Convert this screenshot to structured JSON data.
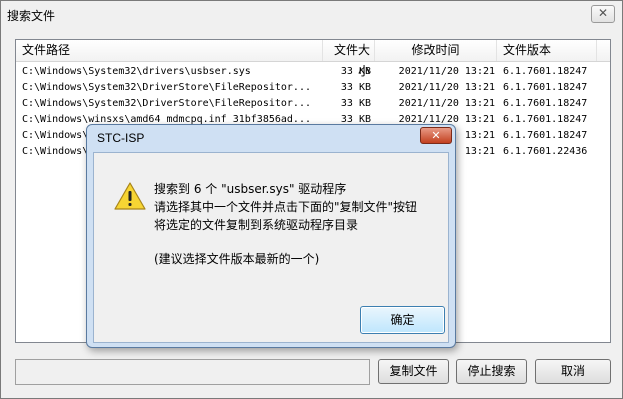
{
  "window": {
    "title": "搜索文件",
    "close_glyph": "✕"
  },
  "table": {
    "columns": [
      "文件路径",
      "文件大小",
      "修改时间",
      "文件版本"
    ],
    "rows": [
      {
        "path": "C:\\Windows\\System32\\drivers\\usbser.sys",
        "size": "33 KB",
        "date": "2021/11/20 13:21",
        "version": "6.1.7601.18247"
      },
      {
        "path": "C:\\Windows\\System32\\DriverStore\\FileRepositor...",
        "size": "33 KB",
        "date": "2021/11/20 13:21",
        "version": "6.1.7601.18247"
      },
      {
        "path": "C:\\Windows\\System32\\DriverStore\\FileRepositor...",
        "size": "33 KB",
        "date": "2021/11/20 13:21",
        "version": "6.1.7601.18247"
      },
      {
        "path": "C:\\Windows\\winsxs\\amd64_mdmcpq.inf_31bf3856ad...",
        "size": "33 KB",
        "date": "2021/11/20 13:21",
        "version": "6.1.7601.18247"
      },
      {
        "path": "C:\\Windows\\",
        "size": "",
        "date": "13:21",
        "version": "6.1.7601.18247"
      },
      {
        "path": "C:\\Windows\\",
        "size": "",
        "date": "13:21",
        "version": "6.1.7601.22436"
      }
    ]
  },
  "status_text": "",
  "buttons": {
    "copy": "复制文件",
    "stop": "停止搜索",
    "cancel": "取消"
  },
  "dialog": {
    "title": "STC-ISP",
    "close_glyph": "✕",
    "icon": "warning-icon",
    "line1": "搜索到 6 个 \"usbser.sys\" 驱动程序",
    "line2": "请选择其中一个文件并点击下面的\"复制文件\"按钮",
    "line3": "将选定的文件复制到系统驱动程序目录",
    "line4": "(建议选择文件版本最新的一个)",
    "ok": "确定"
  }
}
